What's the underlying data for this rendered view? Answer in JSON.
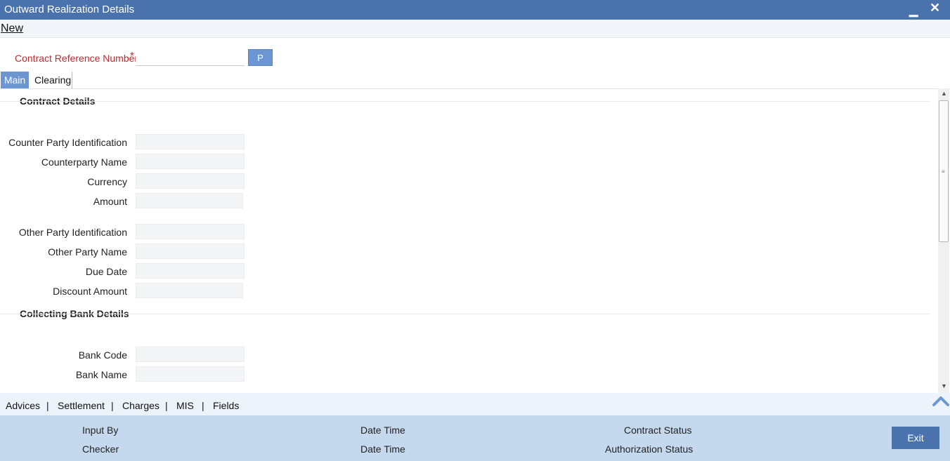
{
  "window": {
    "title": "Outward Realization Details",
    "minimize_glyph": "▁",
    "close_glyph": "✕"
  },
  "menu": {
    "new_label": "New"
  },
  "contract_ref": {
    "label": "Contract Reference Number",
    "required_mark": "*",
    "value": "",
    "p_button": "P"
  },
  "tabs": [
    {
      "label": "Main"
    },
    {
      "label": "Clearing"
    }
  ],
  "contract_details": {
    "title": "Contract Details",
    "fields": [
      {
        "label": "Counter Party Identification"
      },
      {
        "label": "Counterparty Name"
      },
      {
        "label": "Currency"
      },
      {
        "label": "Amount"
      },
      {
        "label": "Other Party Identification"
      },
      {
        "label": "Other Party Name"
      },
      {
        "label": "Due Date"
      },
      {
        "label": "Discount Amount"
      }
    ]
  },
  "collecting_bank": {
    "title": "Collecting Bank Details",
    "fields": [
      {
        "label": "Bank Code"
      },
      {
        "label": "Bank Name"
      }
    ]
  },
  "subnav": {
    "items": [
      "Advices",
      "Settlement",
      "Charges",
      "MIS",
      "Fields"
    ],
    "separator": "|"
  },
  "footer": {
    "input_by": "Input By",
    "checker": "Checker",
    "date_time_1": "Date Time",
    "date_time_2": "Date Time",
    "contract_status": "Contract Status",
    "authorization_status": "Authorization Status",
    "exit_label": "Exit"
  },
  "icons": {
    "scroll_up": "▲",
    "scroll_down": "▼",
    "scroll_grip": "≡"
  },
  "colors": {
    "title_bar": "#4a73ad",
    "accent": "#6b96d2",
    "required": "#c0272d",
    "footer": "#c5d9ee"
  }
}
